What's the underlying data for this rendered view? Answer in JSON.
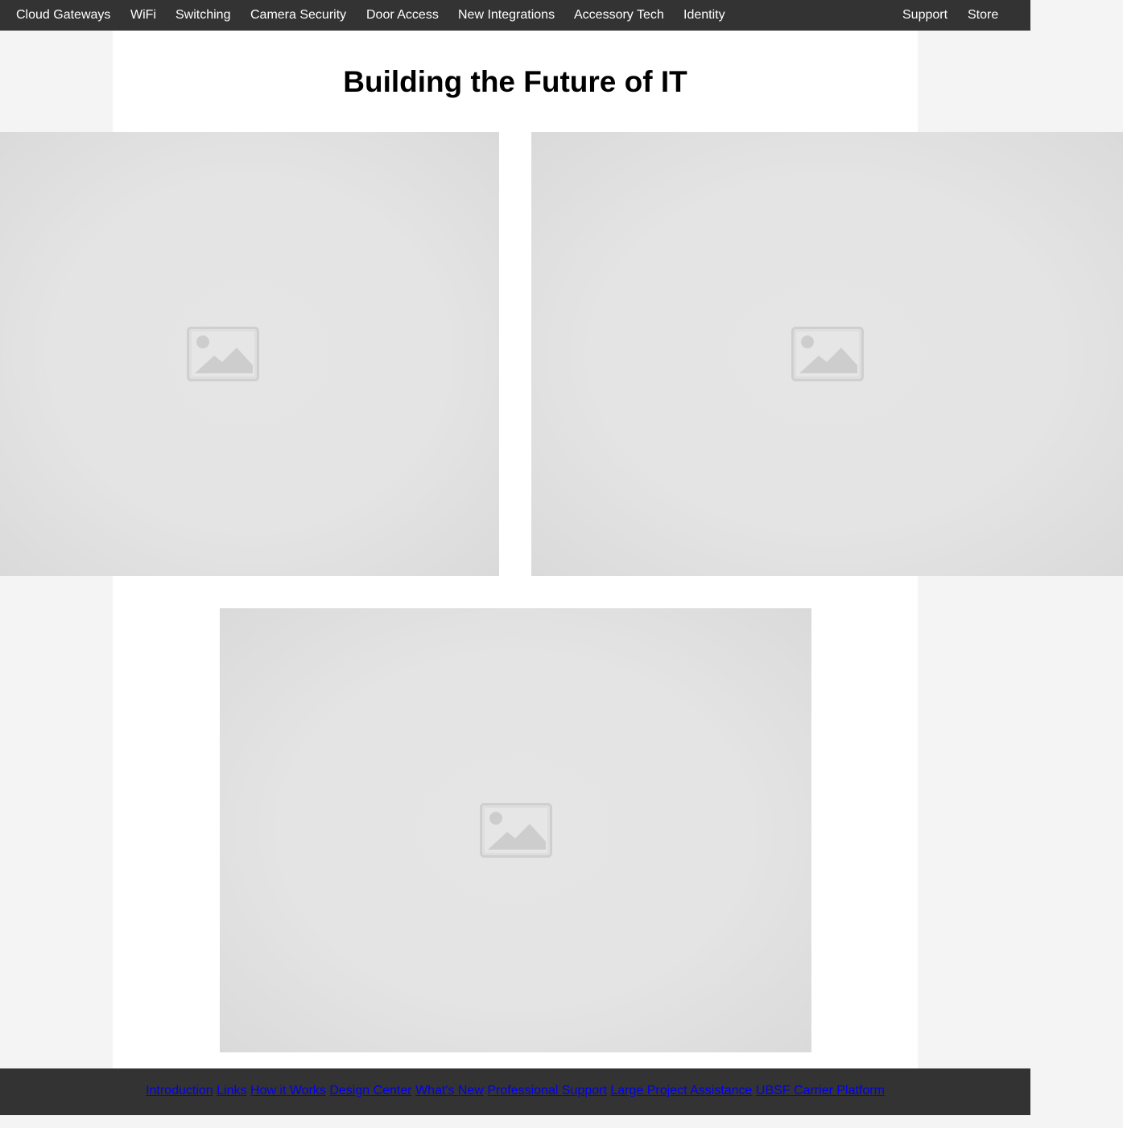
{
  "nav": {
    "items": [
      {
        "label": "Cloud Gateways"
      },
      {
        "label": "WiFi"
      },
      {
        "label": "Switching"
      },
      {
        "label": "Camera Security"
      },
      {
        "label": "Door Access"
      },
      {
        "label": "New Integrations"
      },
      {
        "label": "Accessory Tech"
      },
      {
        "label": "Identity"
      }
    ],
    "support_label": "Support",
    "store_label": "Store"
  },
  "page": {
    "title": "Building the Future of IT"
  },
  "images": [
    {
      "icon": "image-placeholder-icon"
    },
    {
      "icon": "image-placeholder-icon"
    },
    {
      "icon": "image-placeholder-icon"
    }
  ],
  "footer": {
    "links": [
      {
        "label": "Introduction"
      },
      {
        "label": "Links"
      },
      {
        "label": "How it Works"
      },
      {
        "label": "Design Center"
      },
      {
        "label": "What's New"
      },
      {
        "label": "Professional Support"
      },
      {
        "label": "Large Project Assistance"
      },
      {
        "label": "UBSF Carrier Platform"
      }
    ]
  },
  "colors": {
    "nav_background": "#333333",
    "nav_text": "#ffffff",
    "page_background": "#f4f4f4",
    "content_background": "#ffffff",
    "footer_link": "#0000ee",
    "placeholder": "#e4e4e4"
  }
}
